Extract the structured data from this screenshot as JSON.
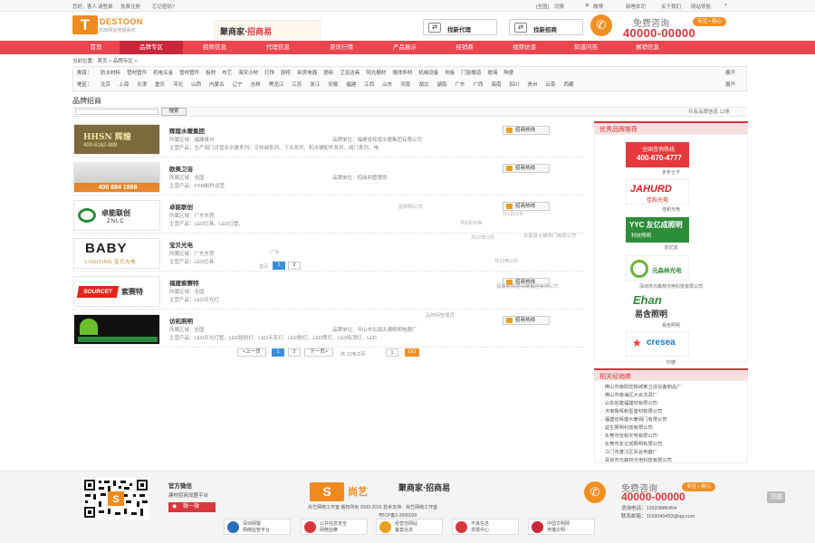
{
  "topbar": {
    "greeting": "您好，",
    "guest": "客人",
    "login": "请登录",
    "register": "免费注册",
    "forgot": "忘记密码?",
    "region": "[全国]",
    "switch": "切换",
    "weibo": "微博",
    "new_hotline": "新哩本司",
    "about": "关于我们",
    "nav_menu": "网站导航"
  },
  "header": {
    "logo_letter": "T",
    "logo_name": "DESTOON",
    "logo_sub": "B2B网站管理系统",
    "slogan_a": "聚商家",
    "slogan_b": "招商易",
    "btn_agent": "找新代理",
    "btn_invest": "找新招商",
    "consult": "免费咨询",
    "hotline": "40000-00000",
    "pill": "专注 • 用心"
  },
  "nav": [
    "首页",
    "品牌专区",
    "招商信息",
    "代理信息",
    "资讯行情",
    "产品展示",
    "经销商",
    "视频访谈",
    "知道问答",
    "展销信息"
  ],
  "breadcrumb": "当前位置：首页 > 品牌专区 >",
  "filter": {
    "cat_label": "类目：",
    "cats": [
      "防水材料",
      "管材管件",
      "机电五金",
      "管材管件",
      "板材",
      "布艺",
      "海安沙材",
      "灯饰",
      "厨柜",
      "卧房电器",
      "瓷砖",
      "卫浴洁具",
      "阳光棚材",
      "墙体饰材",
      "机械设备",
      "地板",
      "门窗楼道",
      "玻璃",
      "陶瓷"
    ],
    "region_label": "地区：",
    "regions": [
      "北京",
      "上海",
      "天津",
      "重庆",
      "河北",
      "山西",
      "内蒙古",
      "辽宁",
      "吉林",
      "黑龙江",
      "江苏",
      "浙江",
      "安徽",
      "福建",
      "江西",
      "山东",
      "河南",
      "湖北",
      "湖南",
      "广东",
      "广西",
      "海南",
      "四川",
      "贵州",
      "云南",
      "西藏"
    ],
    "more": "展开"
  },
  "list": {
    "title": "品牌招商",
    "search_btn": "搜索",
    "total": "共有品牌信息 12条",
    "hot_label": "招商热线",
    "items": [
      {
        "name": "辉煌水暖集团",
        "logo": "HHSN 辉煌",
        "logo_sub": "400-6162-888",
        "area": "所属区域：福建泉州",
        "prod": "主营产品：生产阀门并营业水暖系列：冷热阀系列、下水系列、机水辅配件系列、阀门系列、电",
        "unit": "品牌单位：福建省辉煌水暖集团有限公司"
      },
      {
        "name": "欧美卫浴",
        "logo": "",
        "logo_sub": "400 884 1868",
        "area": "所属区域：全国",
        "prod": "主营产品：FSM制作运营",
        "unit": "品牌单位：招商网管理员"
      },
      {
        "name": "卓能联创",
        "logo": "卓能联创",
        "logo_sub": "ZNLC",
        "area": "所属区域：广东东莞",
        "prod": "主营产品：LED灯具、LED灯管、",
        "unit": ""
      },
      {
        "name": "宝贝光电",
        "logo": "BABY",
        "logo_sub": "LIGHTING 宝贝光电",
        "area": "所属区域：广东东莞",
        "prod": "主营产品：LED灯具",
        "unit": ""
      },
      {
        "name": "福建索赛特",
        "logo": "SOURCET",
        "logo_sub": "索赛特",
        "area": "所属区域：全国",
        "prod": "主营产品：LED日光灯",
        "unit": ""
      },
      {
        "name": "访拓照明",
        "logo": "",
        "logo_sub": "",
        "area": "所属区域：全国",
        "prod": "主营产品：LED日光灯管、LED投射灯、LED天花灯、LED射灯、LED筒灯、LED吸顶灯、LED",
        "unit": "品牌单位：中山市古镇天通照明电器厂"
      }
    ],
    "ghost": {
      "a": "品牌网公司",
      "b": "共6页20条",
      "c": "共12条/2页",
      "d": "永嘉县水暖阀门有限公司",
      "e": "共12条/2页",
      "f": "广东",
      "g": "共1页/2页",
      "h": "品牌网管理员",
      "i": "首页",
      "j": "福建省辉煌水暖集团有限公司"
    },
    "pager": {
      "prev": "<上一页",
      "p1": "1",
      "p2": "2",
      "next": "下一页>",
      "info": "共 12条/2页",
      "input": "1",
      "go": "GO"
    }
  },
  "rec": {
    "title": "优秀品牌推荐",
    "items": [
      {
        "cap": "步步士卡",
        "logo": "全国咨询热线",
        "tel": "400-670-4777"
      },
      {
        "cap": "佳和光电",
        "logo": "JAHURD",
        "tel": "佳和光电"
      },
      {
        "cap": "友亿成",
        "logo": "YYC 友亿成照明",
        "tel": "科技照明"
      },
      {
        "cap": "深圳市元森林光电科技有限公司",
        "logo": "元森林光电",
        "tel": ""
      },
      {
        "cap": "易含照明",
        "logo": "Ehan",
        "tel": "易含照明"
      },
      {
        "cap": "印德",
        "logo": "cresea",
        "tel": "印德"
      }
    ]
  },
  "related": {
    "title": "相关经销商",
    "items": [
      "佛山市南阳宏辉城某卫浴设备制品厂",
      "佛山市南海区大会法具厂",
      "山东省建福建材有限公司",
      "济南鲁晖新型建材有限公司",
      "福建省辉煌水暖阀门有限公司",
      "益生照明科技有限公司",
      "东莞市佳和光电有限公司",
      "东莞市友亿成照明有限公司",
      "江门市蓬江区风谷电器厂",
      "深圳市元森林光电科技有限公司"
    ]
  },
  "footer": {
    "wechat_title": "官方微信",
    "wechat_sub": "建材招商加盟平台",
    "weibo_btn": "微一微",
    "logo_text": "尚艺",
    "slogan": "聚商家·招商易",
    "copyright": "尚艺网络工作室 版权所有 2000-2015 技术支持：尚艺网络工作室",
    "icp": "粤ICP备2-2006039",
    "consult": "免费咨询",
    "hotline": "40000-00000",
    "pill": "专注 • 用心",
    "phone": "咨询电话：13933886454",
    "email": "联系邮箱：1159040453@qq.com",
    "badges": [
      {
        "t1": "深圳网警",
        "t2": "网络监管平台"
      },
      {
        "t1": "公共信息安全",
        "t2": "网络监察"
      },
      {
        "t1": "经营性网站",
        "t2": "备案信息"
      },
      {
        "t1": "不良信息",
        "t2": "举报中心"
      },
      {
        "t1": "中国文明网",
        "t2": "传播文明"
      }
    ],
    "side_btn": "顶部"
  },
  "colors": {
    "brand_red": "#e8474f",
    "brand_orange": "#f08a1c",
    "link_blue": "#3b8fd9"
  }
}
